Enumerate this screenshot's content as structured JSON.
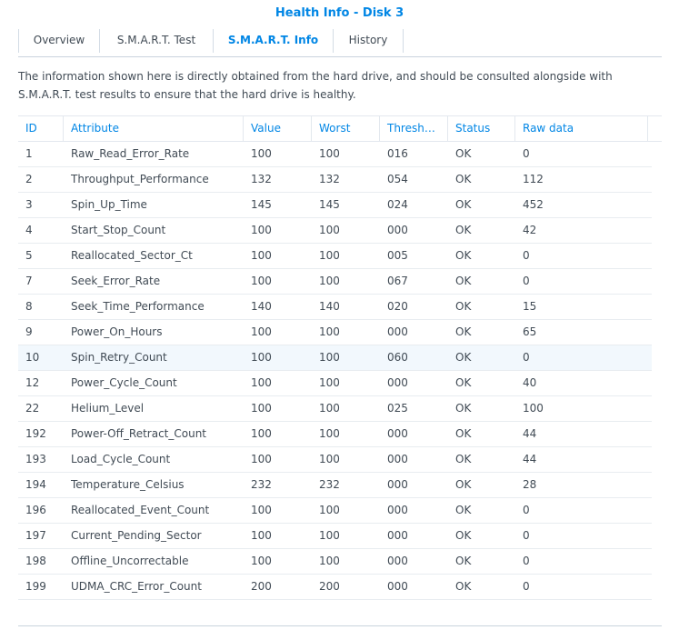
{
  "window": {
    "title": "Health Info - Disk 3"
  },
  "tabs": [
    {
      "label": "Overview"
    },
    {
      "label": "S.M.A.R.T. Test"
    },
    {
      "label": "S.M.A.R.T. Info"
    },
    {
      "label": "History"
    }
  ],
  "active_tab": "S.M.A.R.T. Info",
  "description": "The information shown here is directly obtained from the hard drive, and should be consulted alongside with S.M.A.R.T. test results to ensure that the hard drive is healthy.",
  "table": {
    "columns": [
      "ID",
      "Attribute",
      "Value",
      "Worst",
      "Thresh…",
      "Status",
      "Raw data"
    ],
    "rows": [
      {
        "id": "1",
        "attribute": "Raw_Read_Error_Rate",
        "value": "100",
        "worst": "100",
        "thresh": "016",
        "status": "OK",
        "raw": "0"
      },
      {
        "id": "2",
        "attribute": "Throughput_Performance",
        "value": "132",
        "worst": "132",
        "thresh": "054",
        "status": "OK",
        "raw": "112"
      },
      {
        "id": "3",
        "attribute": "Spin_Up_Time",
        "value": "145",
        "worst": "145",
        "thresh": "024",
        "status": "OK",
        "raw": "452"
      },
      {
        "id": "4",
        "attribute": "Start_Stop_Count",
        "value": "100",
        "worst": "100",
        "thresh": "000",
        "status": "OK",
        "raw": "42"
      },
      {
        "id": "5",
        "attribute": "Reallocated_Sector_Ct",
        "value": "100",
        "worst": "100",
        "thresh": "005",
        "status": "OK",
        "raw": "0"
      },
      {
        "id": "7",
        "attribute": "Seek_Error_Rate",
        "value": "100",
        "worst": "100",
        "thresh": "067",
        "status": "OK",
        "raw": "0"
      },
      {
        "id": "8",
        "attribute": "Seek_Time_Performance",
        "value": "140",
        "worst": "140",
        "thresh": "020",
        "status": "OK",
        "raw": "15"
      },
      {
        "id": "9",
        "attribute": "Power_On_Hours",
        "value": "100",
        "worst": "100",
        "thresh": "000",
        "status": "OK",
        "raw": "65"
      },
      {
        "id": "10",
        "attribute": "Spin_Retry_Count",
        "value": "100",
        "worst": "100",
        "thresh": "060",
        "status": "OK",
        "raw": "0"
      },
      {
        "id": "12",
        "attribute": "Power_Cycle_Count",
        "value": "100",
        "worst": "100",
        "thresh": "000",
        "status": "OK",
        "raw": "40"
      },
      {
        "id": "22",
        "attribute": "Helium_Level",
        "value": "100",
        "worst": "100",
        "thresh": "025",
        "status": "OK",
        "raw": "100"
      },
      {
        "id": "192",
        "attribute": "Power-Off_Retract_Count",
        "value": "100",
        "worst": "100",
        "thresh": "000",
        "status": "OK",
        "raw": "44"
      },
      {
        "id": "193",
        "attribute": "Load_Cycle_Count",
        "value": "100",
        "worst": "100",
        "thresh": "000",
        "status": "OK",
        "raw": "44"
      },
      {
        "id": "194",
        "attribute": "Temperature_Celsius",
        "value": "232",
        "worst": "232",
        "thresh": "000",
        "status": "OK",
        "raw": "28"
      },
      {
        "id": "196",
        "attribute": "Reallocated_Event_Count",
        "value": "100",
        "worst": "100",
        "thresh": "000",
        "status": "OK",
        "raw": "0"
      },
      {
        "id": "197",
        "attribute": "Current_Pending_Sector",
        "value": "100",
        "worst": "100",
        "thresh": "000",
        "status": "OK",
        "raw": "0"
      },
      {
        "id": "198",
        "attribute": "Offline_Uncorrectable",
        "value": "100",
        "worst": "100",
        "thresh": "000",
        "status": "OK",
        "raw": "0"
      },
      {
        "id": "199",
        "attribute": "UDMA_CRC_Error_Count",
        "value": "200",
        "worst": "200",
        "thresh": "000",
        "status": "OK",
        "raw": "0"
      }
    ],
    "highlighted_row_id": "10"
  },
  "colors": {
    "accent": "#0086e5",
    "text": "#414b55",
    "row_highlight": "#f2f8fd",
    "border": "#e3e8ee"
  }
}
